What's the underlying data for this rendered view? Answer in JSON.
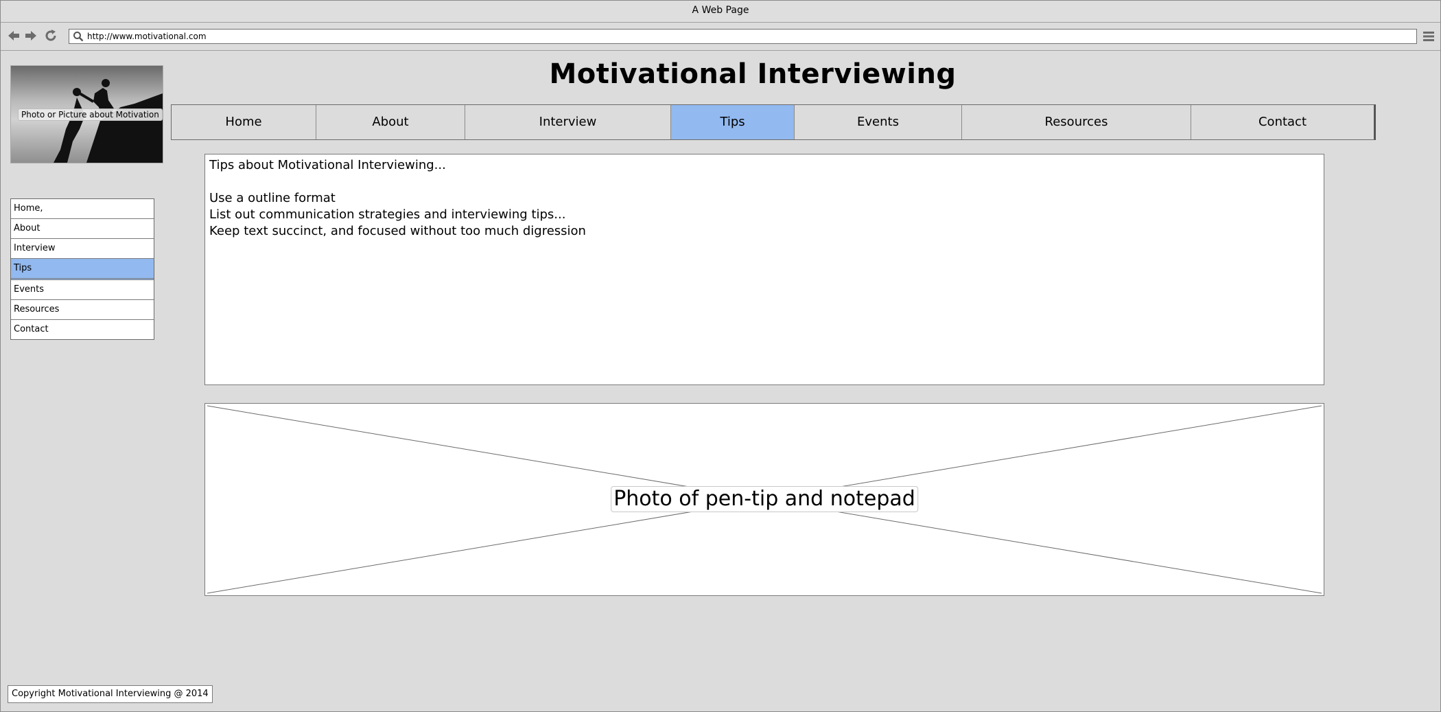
{
  "window": {
    "title": "A Web Page"
  },
  "browser": {
    "url": "http://www.motivational.com"
  },
  "logo": {
    "caption": "Photo or Picture about Motivation"
  },
  "header": {
    "title": "Motivational Interviewing"
  },
  "topnav": {
    "tabs": [
      {
        "label": "Home"
      },
      {
        "label": "About"
      },
      {
        "label": "Interview"
      },
      {
        "label": "Tips"
      },
      {
        "label": "Events"
      },
      {
        "label": "Resources"
      },
      {
        "label": "Contact"
      }
    ],
    "active": "Tips"
  },
  "sidenav": {
    "items": [
      {
        "label": "Home,"
      },
      {
        "label": "About"
      },
      {
        "label": "Interview"
      },
      {
        "label": "Tips"
      },
      {
        "label": "Events"
      },
      {
        "label": "Resources"
      },
      {
        "label": "Contact"
      }
    ],
    "active": "Tips"
  },
  "content": {
    "heading": "Tips about Motivational Interviewing...",
    "lines": [
      "Use a outline format",
      "List out communication strategies and interviewing tips...",
      "Keep text succinct, and focused without too much digression"
    ]
  },
  "image_placeholder": {
    "caption": "Photo of pen-tip and notepad"
  },
  "footer": {
    "copyright": "Copyright Motivational Interviewing @ 2014"
  },
  "colors": {
    "active_tab": "#92b9f0",
    "background": "#dcdcdc"
  }
}
